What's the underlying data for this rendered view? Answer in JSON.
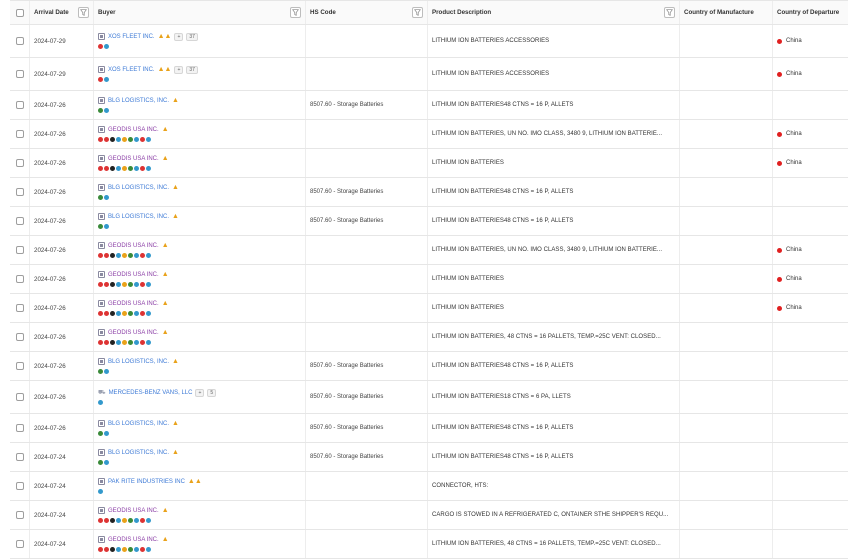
{
  "columns": {
    "arrival_date": "Arrival Date",
    "buyer": "Buyer",
    "hs_code": "HS Code",
    "product_description": "Product Description",
    "country_of_manufacture": "Country of Manufacture",
    "country_of_departure": "Country of Departure"
  },
  "colors": {
    "link_blue": "#3d7ad6",
    "link_purple": "#8b3fa6",
    "warning": "#e9a21a",
    "china_dot": "#e02020"
  },
  "rows": [
    {
      "date": "2024-07-29",
      "buyer": "XOS FLEET INC.",
      "buyer_color": "blue",
      "icon": "building-icon",
      "warn": "▲▲",
      "chips": [
        "+",
        "37"
      ],
      "flags": [
        "#d33",
        "#39c"
      ],
      "hs": "",
      "desc": "LITHIUM ION BATTERIES ACCESSORIES",
      "manu": "",
      "dep": "China",
      "height": 33
    },
    {
      "date": "2024-07-29",
      "buyer": "XOS FLEET INC.",
      "buyer_color": "blue",
      "icon": "building-icon",
      "warn": "▲▲",
      "chips": [
        "+",
        "37"
      ],
      "flags": [
        "#d33",
        "#39c"
      ],
      "hs": "",
      "desc": "LITHIUM ION BATTERIES ACCESSORIES",
      "manu": "",
      "dep": "China",
      "height": 33
    },
    {
      "date": "2024-07-26",
      "buyer": "BLG LOGISTICS, INC.",
      "buyer_color": "blue",
      "icon": "building-icon",
      "warn": "▲",
      "chips": [],
      "flags": [
        "#3a8a3a",
        "#39c"
      ],
      "hs": "8507.60 - Storage Batteries",
      "desc": "LITHIUM ION BATTERIES48 CTNS = 16 P, ALLETS",
      "manu": "",
      "dep": "",
      "height": 29
    },
    {
      "date": "2024-07-26",
      "buyer": "GEODIS USA INC.",
      "buyer_color": "purple",
      "icon": "building-icon",
      "warn": "▲",
      "chips": [],
      "flags": [
        "#d33",
        "#d33",
        "#222",
        "#39c",
        "#e9a21a",
        "#3a8a3a",
        "#39c",
        "#d33",
        "#39c"
      ],
      "hs": "",
      "desc": "LITHIUM ION BATTERIES, UN NO. IMO CLASS, 3480 9, LITHIUM ION BATTERIE...",
      "manu": "",
      "dep": "China",
      "height": 29
    },
    {
      "date": "2024-07-26",
      "buyer": "GEODIS USA INC.",
      "buyer_color": "purple",
      "icon": "building-icon",
      "warn": "▲",
      "chips": [],
      "flags": [
        "#d33",
        "#d33",
        "#222",
        "#39c",
        "#e9a21a",
        "#3a8a3a",
        "#39c",
        "#d33",
        "#39c"
      ],
      "hs": "",
      "desc": "LITHIUM ION BATTERIES",
      "manu": "",
      "dep": "China",
      "height": 29
    },
    {
      "date": "2024-07-26",
      "buyer": "BLG LOGISTICS, INC.",
      "buyer_color": "blue",
      "icon": "building-icon",
      "warn": "▲",
      "chips": [],
      "flags": [
        "#3a8a3a",
        "#39c"
      ],
      "hs": "8507.60 - Storage Batteries",
      "desc": "LITHIUM ION BATTERIES48 CTNS = 16 P, ALLETS",
      "manu": "",
      "dep": "",
      "height": 29
    },
    {
      "date": "2024-07-26",
      "buyer": "BLG LOGISTICS, INC.",
      "buyer_color": "blue",
      "icon": "building-icon",
      "warn": "▲",
      "chips": [],
      "flags": [
        "#3a8a3a",
        "#39c"
      ],
      "hs": "8507.60 - Storage Batteries",
      "desc": "LITHIUM ION BATTERIES48 CTNS = 16 P, ALLETS",
      "manu": "",
      "dep": "",
      "height": 29
    },
    {
      "date": "2024-07-26",
      "buyer": "GEODIS USA INC.",
      "buyer_color": "purple",
      "icon": "building-icon",
      "warn": "▲",
      "chips": [],
      "flags": [
        "#d33",
        "#d33",
        "#222",
        "#39c",
        "#e9a21a",
        "#3a8a3a",
        "#39c",
        "#d33",
        "#39c"
      ],
      "hs": "",
      "desc": "LITHIUM ION BATTERIES, UN NO. IMO CLASS, 3480 9, LITHIUM ION BATTERIE...",
      "manu": "",
      "dep": "China",
      "height": 29
    },
    {
      "date": "2024-07-26",
      "buyer": "GEODIS USA INC.",
      "buyer_color": "purple",
      "icon": "building-icon",
      "warn": "▲",
      "chips": [],
      "flags": [
        "#d33",
        "#d33",
        "#222",
        "#39c",
        "#e9a21a",
        "#3a8a3a",
        "#39c",
        "#d33",
        "#39c"
      ],
      "hs": "",
      "desc": "LITHIUM ION BATTERIES",
      "manu": "",
      "dep": "China",
      "height": 29
    },
    {
      "date": "2024-07-26",
      "buyer": "GEODIS USA INC.",
      "buyer_color": "purple",
      "icon": "building-icon",
      "warn": "▲",
      "chips": [],
      "flags": [
        "#d33",
        "#d33",
        "#222",
        "#39c",
        "#e9a21a",
        "#3a8a3a",
        "#39c",
        "#d33",
        "#39c"
      ],
      "hs": "",
      "desc": "LITHIUM ION BATTERIES",
      "manu": "",
      "dep": "China",
      "height": 29
    },
    {
      "date": "2024-07-26",
      "buyer": "GEODIS USA INC.",
      "buyer_color": "purple",
      "icon": "building-icon",
      "warn": "▲",
      "chips": [],
      "flags": [
        "#d33",
        "#d33",
        "#222",
        "#39c",
        "#e9a21a",
        "#3a8a3a",
        "#39c",
        "#d33",
        "#39c"
      ],
      "hs": "",
      "desc": "LITHIUM ION BATTERIES, 48 CTNS = 16 PALLETS, TEMP.=25C VENT: CLOSED...",
      "manu": "",
      "dep": "",
      "height": 29
    },
    {
      "date": "2024-07-26",
      "buyer": "BLG LOGISTICS, INC.",
      "buyer_color": "blue",
      "icon": "building-icon",
      "warn": "▲",
      "chips": [],
      "flags": [
        "#3a8a3a",
        "#39c"
      ],
      "hs": "8507.60 - Storage Batteries",
      "desc": "LITHIUM ION BATTERIES48 CTNS = 16 P, ALLETS",
      "manu": "",
      "dep": "",
      "height": 29
    },
    {
      "date": "2024-07-26",
      "buyer": "MERCEDES-BENZ VANS, LLC",
      "buyer_color": "blue",
      "icon": "truck-icon",
      "warn": "",
      "chips": [
        "+",
        "5"
      ],
      "flags": [
        "#39c"
      ],
      "hs": "8507.60 - Storage Batteries",
      "desc": "LITHIUM ION BATTERIES18 CTNS = 6 PA, LLETS",
      "manu": "",
      "dep": "",
      "height": 33
    },
    {
      "date": "2024-07-26",
      "buyer": "BLG LOGISTICS, INC.",
      "buyer_color": "blue",
      "icon": "building-icon",
      "warn": "▲",
      "chips": [],
      "flags": [
        "#3a8a3a",
        "#39c"
      ],
      "hs": "8507.60 - Storage Batteries",
      "desc": "LITHIUM ION BATTERIES48 CTNS = 16 P, ALLETS",
      "manu": "",
      "dep": "",
      "height": 29
    },
    {
      "date": "2024-07-24",
      "buyer": "BLG LOGISTICS, INC.",
      "buyer_color": "blue",
      "icon": "building-icon",
      "warn": "▲",
      "chips": [],
      "flags": [
        "#3a8a3a",
        "#39c"
      ],
      "hs": "8507.60 - Storage Batteries",
      "desc": "LITHIUM ION BATTERIES48 CTNS = 16 P, ALLETS",
      "manu": "",
      "dep": "",
      "height": 29
    },
    {
      "date": "2024-07-24",
      "buyer": "PAK RITE INDUSTRIES INC",
      "buyer_color": "blue",
      "icon": "building-icon",
      "warn": "▲▲",
      "chips": [],
      "flags": [
        "#39c"
      ],
      "hs": "",
      "desc": "CONNECTOR, HTS:",
      "manu": "",
      "dep": "",
      "height": 29
    },
    {
      "date": "2024-07-24",
      "buyer": "GEODIS USA INC.",
      "buyer_color": "purple",
      "icon": "building-icon",
      "warn": "▲",
      "chips": [],
      "flags": [
        "#d33",
        "#d33",
        "#222",
        "#39c",
        "#e9a21a",
        "#3a8a3a",
        "#39c",
        "#d33",
        "#39c"
      ],
      "hs": "",
      "desc": "CARGO IS STOWED IN A REFRIGERATED C, ONTAINER STHE SHIPPER'S REQU...",
      "manu": "",
      "dep": "",
      "height": 29
    },
    {
      "date": "2024-07-24",
      "buyer": "GEODIS USA INC.",
      "buyer_color": "purple",
      "icon": "building-icon",
      "warn": "▲",
      "chips": [],
      "flags": [
        "#d33",
        "#d33",
        "#222",
        "#39c",
        "#e9a21a",
        "#3a8a3a",
        "#39c",
        "#d33",
        "#39c"
      ],
      "hs": "",
      "desc": "LITHIUM ION BATTERIES, 48 CTNS = 16 PALLETS, TEMP.=25C VENT: CLOSED...",
      "manu": "",
      "dep": "",
      "height": 29
    }
  ]
}
